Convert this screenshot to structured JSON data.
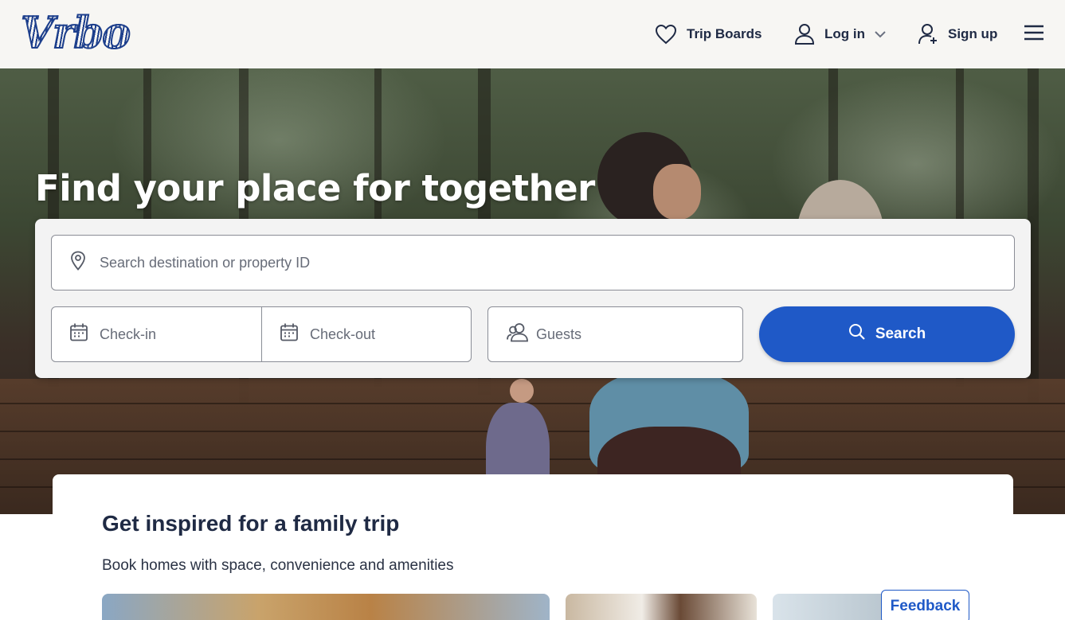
{
  "brand": {
    "logo_text": "Vrbo",
    "color": "#1d3f8c"
  },
  "nav": {
    "trip_boards": "Trip Boards",
    "log_in": "Log in",
    "sign_up": "Sign up"
  },
  "hero": {
    "title": "Find your place for together"
  },
  "search": {
    "destination_placeholder": "Search destination or property ID",
    "checkin_placeholder": "Check-in",
    "checkout_placeholder": "Check-out",
    "guests_placeholder": "Guests",
    "button_label": "Search",
    "button_color": "#1f59c7"
  },
  "inspire": {
    "title": "Get inspired for a family trip",
    "subtitle": "Book homes with space, convenience and amenities"
  },
  "feedback": {
    "label": "Feedback"
  }
}
